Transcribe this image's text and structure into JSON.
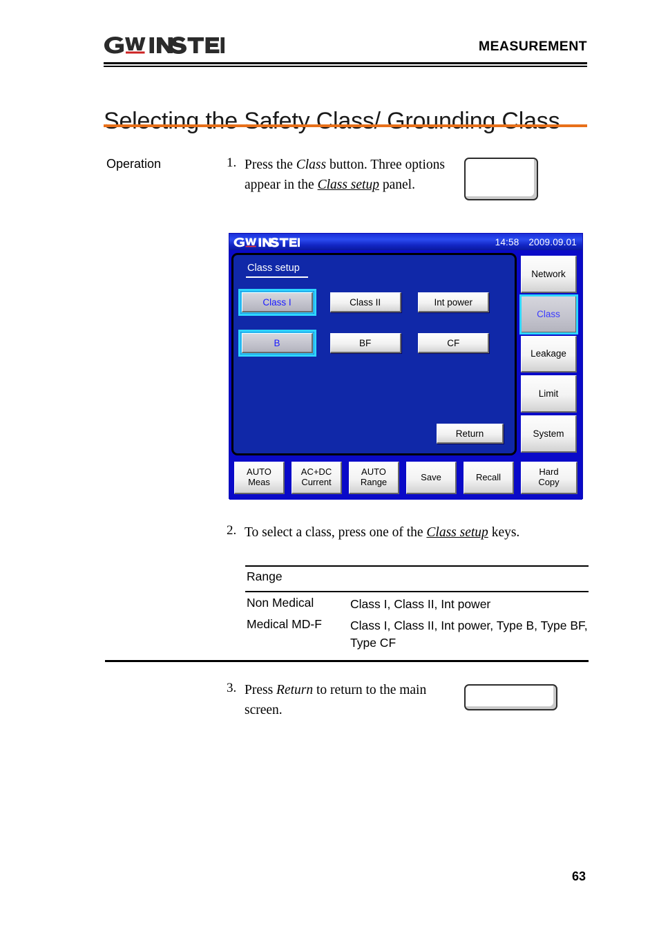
{
  "header": {
    "logo_text": "GW INSTEK",
    "logo_icon": "gw-instek-logo",
    "section_title": "MEASUREMENT"
  },
  "page_title": "Selecting the Safety Class/ Grounding Class",
  "accent_color": "#e8701a",
  "operation": {
    "label": "Operation"
  },
  "steps": [
    {
      "num": "1.",
      "text_parts": {
        "p1": "Press the ",
        "em1": "Class",
        "p2": " button. Three options appear in the ",
        "emu1": "Class setup",
        "p3": " panel."
      }
    },
    {
      "num": "2.",
      "text_parts": {
        "p1": "To select a class, press one of the ",
        "emu1": "Class setup",
        "p2": " keys."
      }
    },
    {
      "num": "3.",
      "text_parts": {
        "p1": "Press ",
        "em1": "Return",
        "p2": " to return to the main screen."
      }
    }
  ],
  "device_screen": {
    "titlebar": {
      "logo": "gw-instek-logo",
      "time": "14:58",
      "date": "2009.09.01"
    },
    "panel": {
      "title": "Class setup",
      "row1": [
        {
          "label": "Class I",
          "selected": true
        },
        {
          "label": "Class II",
          "selected": false
        },
        {
          "label": "Int power",
          "selected": false
        }
      ],
      "row2": [
        {
          "label": "B",
          "selected": true
        },
        {
          "label": "BF",
          "selected": false
        },
        {
          "label": "CF",
          "selected": false
        }
      ],
      "return_label": "Return"
    },
    "side_menu": [
      {
        "label": "Network",
        "selected": false
      },
      {
        "label": "Class",
        "selected": true
      },
      {
        "label": "Leakage",
        "selected": false
      },
      {
        "label": "Limit",
        "selected": false
      },
      {
        "label": "System",
        "selected": false
      }
    ],
    "function_keys": [
      {
        "line1": "AUTO",
        "line2": "Meas"
      },
      {
        "line1": "AC+DC",
        "line2": "Current"
      },
      {
        "line1": "AUTO",
        "line2": "Range"
      },
      {
        "line1": "Save",
        "line2": ""
      },
      {
        "line1": "Recall",
        "line2": ""
      },
      {
        "line1": "Hard",
        "line2": "Copy"
      }
    ],
    "colors": {
      "screen_blue": "#0a0ac8",
      "panel_blue": "#1028a8",
      "highlight_cyan": "#2fd6ff",
      "selected_text_blue": "#1a1aff"
    }
  },
  "table": {
    "header": "Range",
    "rows": [
      {
        "range": "Non Medical",
        "values": "Class I, Class II, Int power"
      },
      {
        "range": "Medical MD-F",
        "values": "Class I, Class II, Int power, Type B, Type BF, Type CF"
      }
    ]
  },
  "footer": {
    "page_number": "63"
  }
}
